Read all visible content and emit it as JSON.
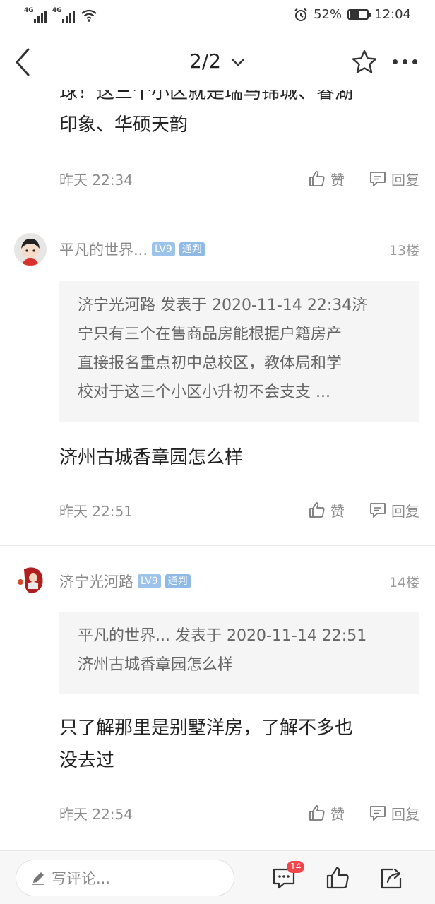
{
  "status": {
    "network1": "4G",
    "network2": "4G",
    "battery_pct": "52%",
    "battery_level": 0.52,
    "time": "12:04"
  },
  "nav": {
    "page_indicator": "2/2"
  },
  "top_post": {
    "text_line1": "球！这三个小区就是瑞马锦城、睿湖",
    "text_line2": "印象、华硕天韵",
    "time": "昨天 22:34",
    "like_label": "赞",
    "reply_label": "回复"
  },
  "posts": [
    {
      "username": "平凡的世界...",
      "level": "LV9",
      "tag": "通判",
      "floor": "13楼",
      "quote_lines": [
        "济宁光河路 发表于 2020-11-14 22:34济",
        "宁只有三个在售商品房能根据户籍房产",
        "直接报名重点初中总校区，教体局和学",
        "校对于这三个小区小升初不会支支 ..."
      ],
      "text_lines": [
        "济州古城香章园怎么样"
      ],
      "time": "昨天 22:51",
      "like_label": "赞",
      "reply_label": "回复"
    },
    {
      "username": "济宁光河路",
      "level": "LV9",
      "tag": "通判",
      "floor": "14楼",
      "quote_lines": [
        "平凡的世界... 发表于 2020-11-14 22:51",
        "济州古城香章园怎么样"
      ],
      "text_lines": [
        "只了解那里是别墅洋房，了解不多也",
        "没去过"
      ],
      "time": "昨天 22:54",
      "like_label": "赞",
      "reply_label": "回复"
    }
  ],
  "bottom": {
    "comment_placeholder": "写评论...",
    "comment_count": "14"
  }
}
